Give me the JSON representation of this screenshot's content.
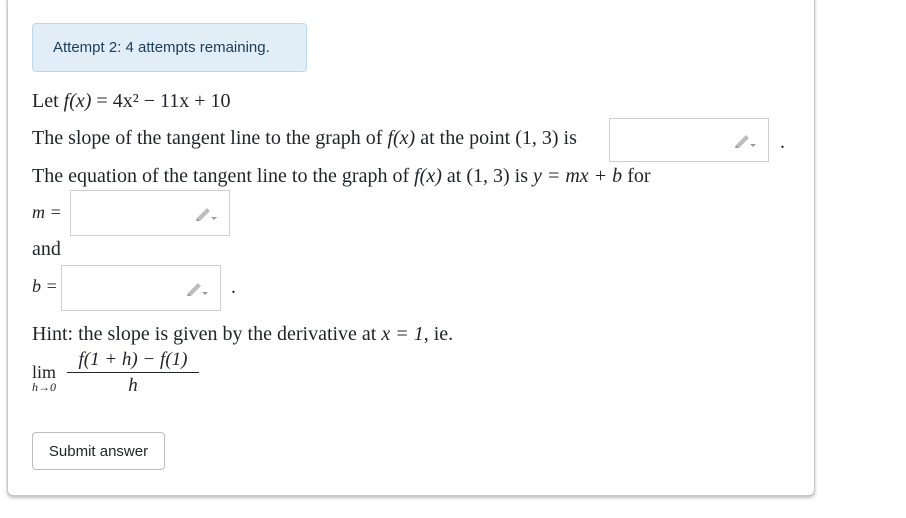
{
  "alert": {
    "text": "Attempt 2: 4 attempts remaining."
  },
  "problem": {
    "line1_prefix": "Let ",
    "line1_fx": "f(x)",
    "line1_rest": " = 4x² − 11x + 10",
    "line2_prefix": "The slope of the tangent line to the graph of ",
    "line2_fx": "f(x)",
    "line2_mid": " at the point ",
    "line2_point": "(1, 3)",
    "line2_suffix": " is",
    "line3_prefix": "The equation of the tangent line to the graph of ",
    "line3_fx": "f(x)",
    "line3_mid": " at ",
    "line3_point": "(1, 3)",
    "line3_is": " is ",
    "line3_eq": "y = mx + b",
    "line3_suffix": " for",
    "m_label": "m =",
    "and_text": "and",
    "b_label": "b =",
    "period": ".",
    "hint_prefix": "Hint: the slope is given by the derivative at ",
    "hint_eq": "x = 1",
    "hint_suffix": ", ie.",
    "lim_text": "lim",
    "lim_sub": "h→0",
    "frac_num": "f(1 + h) − f(1)",
    "frac_den": "h"
  },
  "inputs": {
    "slope_value": "",
    "m_value": "",
    "b_value": ""
  },
  "icons": {
    "answer_tool": "pencil-icon"
  },
  "submit": {
    "label": "Submit answer"
  }
}
